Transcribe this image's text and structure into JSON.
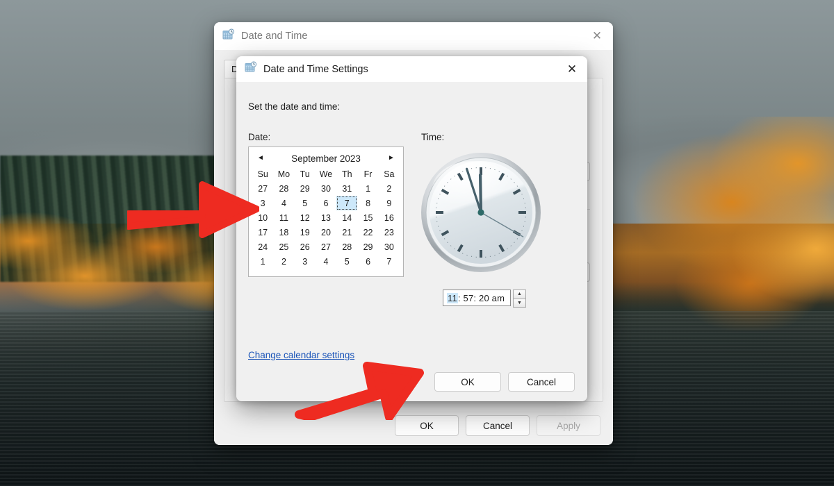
{
  "desktop": {
    "wallpaper_description": "autumn mountain lake"
  },
  "outer_window": {
    "title": "Date and Time",
    "icon": "date-time-icon",
    "close_label": "✕",
    "tab_label": "Date and Time",
    "buttons": [
      {
        "label": "OK",
        "disabled": false
      },
      {
        "label": "Cancel",
        "disabled": false
      },
      {
        "label": "Apply",
        "disabled": true
      }
    ]
  },
  "inner_dialog": {
    "title": "Date and Time Settings",
    "icon": "date-time-icon",
    "close_label": "✕",
    "instruction": "Set the date and time:",
    "date_section_label": "Date:",
    "time_section_label": "Time:",
    "calendar": {
      "prev_arrow": "◄",
      "next_arrow": "►",
      "month_year": "September 2023",
      "weekday_headers": [
        "Su",
        "Mo",
        "Tu",
        "We",
        "Th",
        "Fr",
        "Sa"
      ],
      "selected_day": 7,
      "weeks": [
        [
          {
            "d": "27",
            "m": true
          },
          {
            "d": "28",
            "m": true
          },
          {
            "d": "29",
            "m": true
          },
          {
            "d": "30",
            "m": true
          },
          {
            "d": "31",
            "m": true
          },
          {
            "d": "1",
            "m": false
          },
          {
            "d": "2",
            "m": false
          }
        ],
        [
          {
            "d": "3",
            "m": false
          },
          {
            "d": "4",
            "m": false
          },
          {
            "d": "5",
            "m": false
          },
          {
            "d": "6",
            "m": false
          },
          {
            "d": "7",
            "m": false,
            "sel": true
          },
          {
            "d": "8",
            "m": false
          },
          {
            "d": "9",
            "m": false
          }
        ],
        [
          {
            "d": "10",
            "m": false
          },
          {
            "d": "11",
            "m": false
          },
          {
            "d": "12",
            "m": false
          },
          {
            "d": "13",
            "m": false
          },
          {
            "d": "14",
            "m": false
          },
          {
            "d": "15",
            "m": false
          },
          {
            "d": "16",
            "m": false
          }
        ],
        [
          {
            "d": "17",
            "m": false
          },
          {
            "d": "18",
            "m": false
          },
          {
            "d": "19",
            "m": false
          },
          {
            "d": "20",
            "m": false
          },
          {
            "d": "21",
            "m": false
          },
          {
            "d": "22",
            "m": false
          },
          {
            "d": "23",
            "m": false
          }
        ],
        [
          {
            "d": "24",
            "m": false
          },
          {
            "d": "25",
            "m": false
          },
          {
            "d": "26",
            "m": false
          },
          {
            "d": "27",
            "m": false
          },
          {
            "d": "28",
            "m": false
          },
          {
            "d": "29",
            "m": false
          },
          {
            "d": "30",
            "m": false
          }
        ],
        [
          {
            "d": "1",
            "m": true
          },
          {
            "d": "2",
            "m": true
          },
          {
            "d": "3",
            "m": true
          },
          {
            "d": "4",
            "m": true
          },
          {
            "d": "5",
            "m": true
          },
          {
            "d": "6",
            "m": true
          },
          {
            "d": "7",
            "m": true
          }
        ]
      ]
    },
    "clock": {
      "hour_hand_deg": 359,
      "minute_hand_deg": 342,
      "second_hand_deg": 120
    },
    "time_value": {
      "full": "11: 57: 20 am",
      "hours": "11",
      "rest": ": 57: 20 am",
      "spin_up": "▲",
      "spin_down": "▼"
    },
    "link_label": "Change calendar settings",
    "buttons": [
      {
        "label": "OK",
        "disabled": false
      },
      {
        "label": "Cancel",
        "disabled": false
      }
    ]
  },
  "annotations": {
    "arrow_color": "#ee2b21",
    "arrows": [
      {
        "name": "arrow-pointing-to-dialog-left",
        "direction": "right"
      },
      {
        "name": "arrow-pointing-to-ok-button",
        "direction": "upper-right"
      }
    ]
  }
}
